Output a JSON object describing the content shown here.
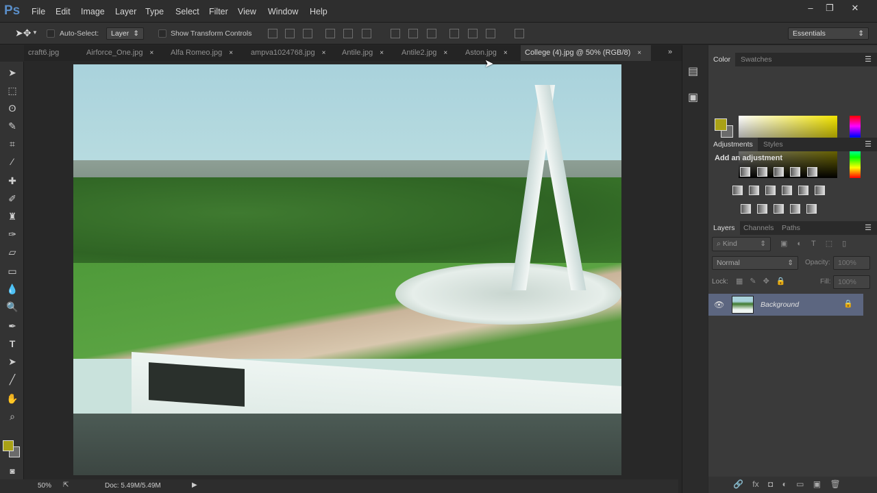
{
  "app": {
    "logo": "Ps",
    "menu": [
      "File",
      "Edit",
      "Image",
      "Layer",
      "Type",
      "Select",
      "Filter",
      "View",
      "Window",
      "Help"
    ],
    "window_controls": [
      "–",
      "❐",
      "✕"
    ]
  },
  "options": {
    "auto_select_label": "Auto-Select:",
    "auto_select_value": "Layer",
    "show_transform_label": "Show Transform Controls",
    "workspace": "Essentials"
  },
  "tabs": [
    {
      "label": "craft6.jpg"
    },
    {
      "label": "Airforce_One.jpg"
    },
    {
      "label": "Alfa Romeo.jpg"
    },
    {
      "label": "ampva1024768.jpg"
    },
    {
      "label": "Antile.jpg"
    },
    {
      "label": "Antile2.jpg"
    },
    {
      "label": "Aston.jpg"
    },
    {
      "label": "College (4).jpg @ 50% (RGB/8)",
      "active": true
    }
  ],
  "tab_close": "×",
  "status": {
    "zoom": "50%",
    "doc": "Doc: 5.49M/5.49M"
  },
  "color_panel": {
    "tabs": [
      "Color",
      "Swatches"
    ],
    "foreground": "#a9a116",
    "background": "#6b6b6b"
  },
  "adjustments_panel": {
    "tabs": [
      "Adjustments",
      "Styles"
    ],
    "title": "Add an adjustment"
  },
  "layers_panel": {
    "tabs": [
      "Layers",
      "Channels",
      "Paths"
    ],
    "filter": "Kind",
    "blend_mode": "Normal",
    "opacity_label": "Opacity:",
    "opacity": "100%",
    "lock_label": "Lock:",
    "fill_label": "Fill:",
    "fill": "100%",
    "layers": [
      {
        "name": "Background",
        "locked": true,
        "visible": true
      }
    ]
  }
}
